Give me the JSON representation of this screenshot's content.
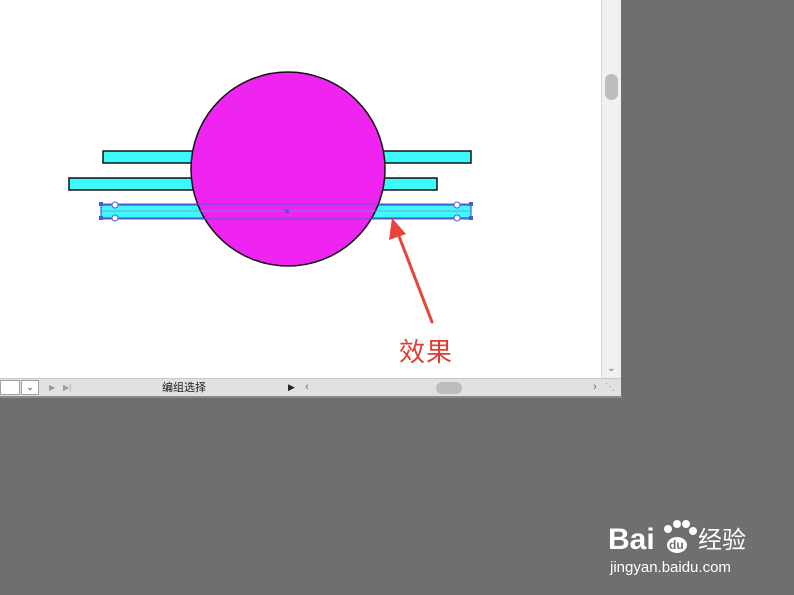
{
  "annotation": {
    "label": "效果",
    "arrow_color": "#e8443a"
  },
  "colors": {
    "circle_fill": "#f024f0",
    "bar_fill": "#3ef9f9",
    "selection": "#4b5bd8",
    "workspace_bg": "#6f6f6f"
  },
  "statusbar": {
    "zoom_value": "",
    "zoom_dropdown_icon": "chevron-down-icon",
    "tool_status": "编组选择",
    "first_page_icon": "first-page-icon",
    "last_page_icon": "last-page-icon"
  },
  "watermark": {
    "brand_left": "Bai",
    "brand_right": "经验",
    "logo_icon": "paw-icon",
    "url": "jingyan.baidu.com"
  }
}
